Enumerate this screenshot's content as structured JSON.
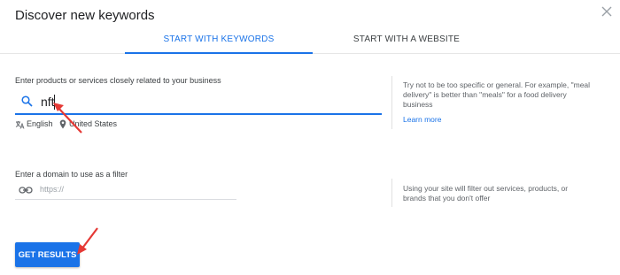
{
  "dialog": {
    "title": "Discover new keywords"
  },
  "tabs": [
    {
      "label": "START WITH KEYWORDS",
      "active": true
    },
    {
      "label": "START WITH A WEBSITE",
      "active": false
    }
  ],
  "keywords": {
    "label": "Enter products or services closely related to your business",
    "value": "nft",
    "language": "English",
    "location": "United States",
    "tip": [
      "Try not to be too specific or general. For example, \"meal",
      "delivery\" is better than \"meals\" for a food delivery",
      "business"
    ],
    "learn_more": "Learn more"
  },
  "domain": {
    "label": "Enter a domain to use as a filter",
    "placeholder": "https://",
    "tip": [
      "Using your site will filter out services, products, or",
      "brands that you don't offer"
    ]
  },
  "actions": {
    "get_results": "GET RESULTS"
  },
  "colors": {
    "accent": "#1a73e8",
    "annotation_arrow": "#e53935"
  }
}
